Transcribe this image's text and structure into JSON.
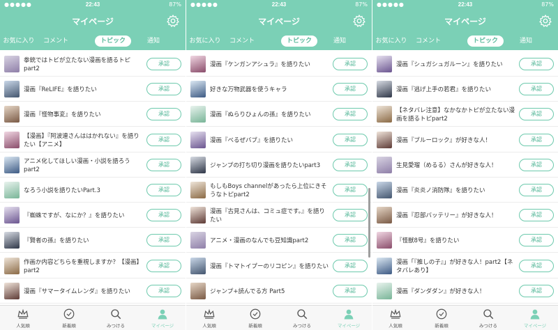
{
  "status": {
    "time": "22:43",
    "battery": "87%"
  },
  "header": {
    "title": "マイページ"
  },
  "tabs": [
    "お気に入り",
    "コメント",
    "トピック",
    "通知"
  ],
  "bottom_nav": [
    "人気順",
    "新着順",
    "みつける",
    "マイページ"
  ],
  "approve_label": "承認",
  "colors": {
    "accent": "#7bd0b6",
    "button_border": "#6cc9ac",
    "active_text": "#58b99b"
  },
  "screens": [
    {
      "rows": [
        "拳銃ではトビが立たない漫画を語るトピpart2",
        "漫画『ReLIFE』を語りたい",
        "漫画『怪物事変』を語りたい",
        "【漫画】『阿波連さんははかれない』を語りたい【アニメ】",
        "アニメ化してほしい漫画・小説を語ろうpart2",
        "なろう小説を語りたいPart.3",
        "『蜘蛛ですが、なにか？』を語りたい",
        "『賢者の孫』を語りたい",
        "作画か内容どちらを重視しますか？【漫画】part2",
        "漫画『サマータイムレンダ』を語りたい"
      ]
    },
    {
      "rows": [
        "漫画『ケンガンアシュラ』を語りたい",
        "好きな万物武器を使うキャラ",
        "漫画『ぬらりひょんの孫』を語りたい",
        "漫画『べるぜバブ』を語りたい",
        "ジャンプの打ち切り漫画を語りたいpart3",
        "もしもBoys channelがあったら上位にきそうなトピpart2",
        "漫画『古見さんは、コミュ症です。』を語りたい",
        "アニメ・漫画のなんでも豆知識part2",
        "漫画『トマトイプーのリコピン』を語りたい",
        "ジャンプ+読んでる方 Part5"
      ]
    },
    {
      "rows": [
        "漫画『シュガシュガルーン』を語りたい",
        "漫画『逃げ上手の若君』を語りたい",
        "【ネタバレ注意】なかなかトピが立たない漫画を語るトピpart2",
        "漫画『ブルーロック』が好きな人！",
        "生見愛瑠（めるる）さんが好きな人！",
        "漫画『炎炎ノ消防隊』を語りたい",
        "漫画『忍部バッテリー』が好きな人！",
        "『怪獣8号』を語りたい",
        "漫画「『推しの子』」が好きな人！part2【ネタバレあり】",
        "漫画『ダンダダン』が好きな人！"
      ]
    }
  ]
}
